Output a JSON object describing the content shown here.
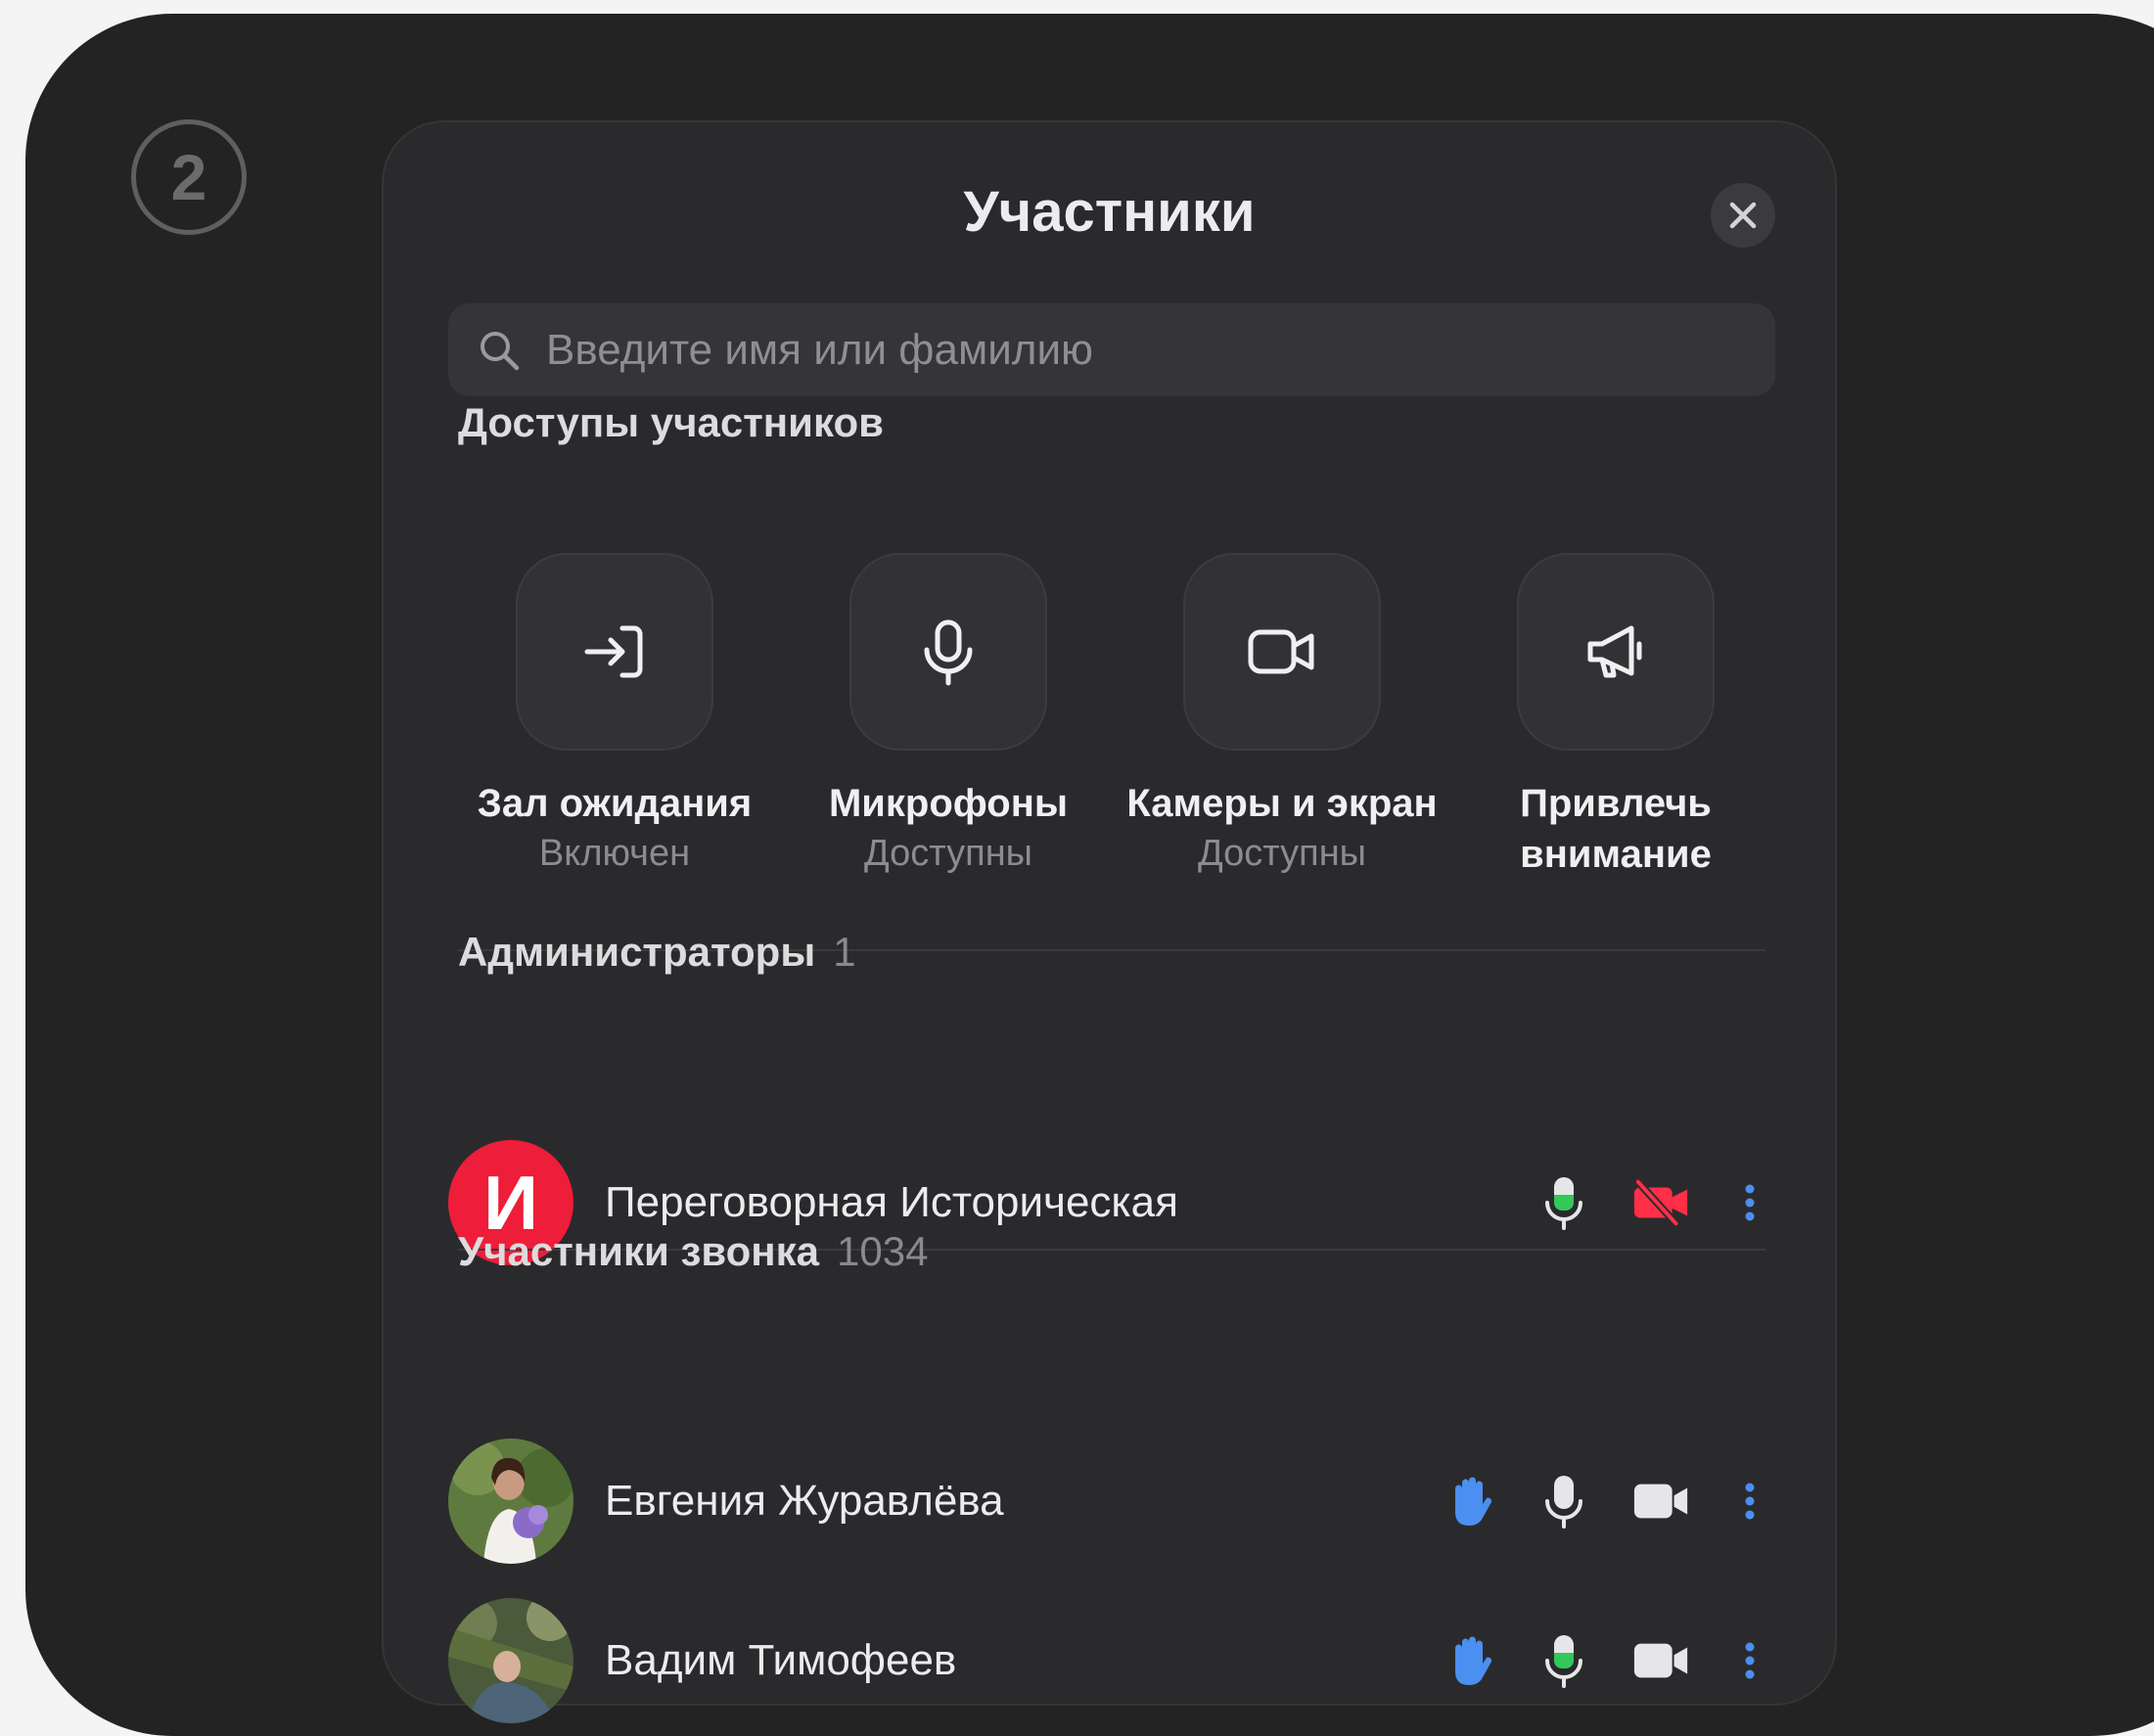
{
  "step": {
    "number": "2"
  },
  "panel": {
    "title": "Участники",
    "search_placeholder": "Введите имя или фамилию"
  },
  "permissions": {
    "title": "Доступы участников",
    "items": [
      {
        "icon": "enter-icon",
        "label": "Зал ожидания",
        "status": "Включен"
      },
      {
        "icon": "microphone-icon",
        "label": "Микрофоны",
        "status": "Доступны"
      },
      {
        "icon": "camera-icon",
        "label": "Камеры и экран",
        "status": "Доступны"
      },
      {
        "icon": "megaphone-icon",
        "label": "Привлечь внимание",
        "label_line1": "Привлечь",
        "label_line2": "внимание"
      }
    ]
  },
  "admins": {
    "title": "Администраторы",
    "count": "1",
    "members": [
      {
        "initial": "И",
        "name": "Переговорная Историческая",
        "mic": "active",
        "camera": "off"
      }
    ]
  },
  "participants": {
    "title": "Участники звонка",
    "count": "1034",
    "members": [
      {
        "name": "Евгения Журавлёва",
        "hand_raised": true,
        "mic": "on",
        "camera": "on"
      },
      {
        "name": "Вадим Тимофеев",
        "hand_raised": true,
        "mic": "active",
        "camera": "on"
      }
    ]
  },
  "colors": {
    "accent_red": "#ee1d39",
    "camera_off": "#ff2f48",
    "mic_active": "#34c759",
    "hand": "#4b8ff0",
    "more": "#4b8ff0"
  }
}
